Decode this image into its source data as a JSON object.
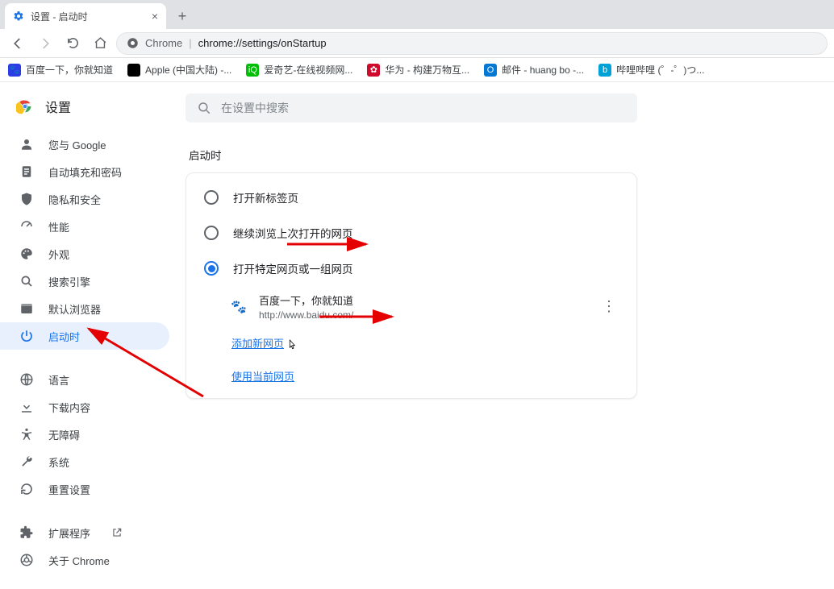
{
  "tab": {
    "title": "设置 - 启动时"
  },
  "omnibox": {
    "label": "Chrome",
    "url": "chrome://settings/onStartup"
  },
  "bookmarks": [
    {
      "label": "百度一下，你就知道",
      "icon": "baidu"
    },
    {
      "label": "Apple (中国大陆) -...",
      "icon": "apple"
    },
    {
      "label": "爱奇艺-在线视频网...",
      "icon": "iqiyi"
    },
    {
      "label": "华为 - 构建万物互...",
      "icon": "huawei"
    },
    {
      "label": "邮件 - huang bo -...",
      "icon": "outlook"
    },
    {
      "label": "哔哩哔哩 (゜-゜)つ...",
      "icon": "bilibili"
    }
  ],
  "settings": {
    "title": "设置",
    "nav": [
      {
        "label": "您与 Google",
        "icon": "person"
      },
      {
        "label": "自动填充和密码",
        "icon": "form"
      },
      {
        "label": "隐私和安全",
        "icon": "shield"
      },
      {
        "label": "性能",
        "icon": "speed"
      },
      {
        "label": "外观",
        "icon": "palette"
      },
      {
        "label": "搜索引擎",
        "icon": "search"
      },
      {
        "label": "默认浏览器",
        "icon": "browser"
      },
      {
        "label": "启动时",
        "icon": "power",
        "active": true
      }
    ],
    "nav2": [
      {
        "label": "语言",
        "icon": "globe"
      },
      {
        "label": "下载内容",
        "icon": "download"
      },
      {
        "label": "无障碍",
        "icon": "accessibility"
      },
      {
        "label": "系统",
        "icon": "wrench"
      },
      {
        "label": "重置设置",
        "icon": "reset"
      }
    ],
    "nav3": [
      {
        "label": "扩展程序",
        "icon": "extension",
        "external": true
      },
      {
        "label": "关于 Chrome",
        "icon": "chrome"
      }
    ],
    "search_placeholder": "在设置中搜索",
    "section": "启动时",
    "radios": [
      {
        "label": "打开新标签页"
      },
      {
        "label": "继续浏览上次打开的网页"
      },
      {
        "label": "打开特定网页或一组网页",
        "selected": true
      }
    ],
    "startup_pages": [
      {
        "title": "百度一下，你就知道",
        "url": "http://www.baidu.com/"
      }
    ],
    "add_page_label": "添加新网页",
    "use_current_label": "使用当前网页"
  }
}
